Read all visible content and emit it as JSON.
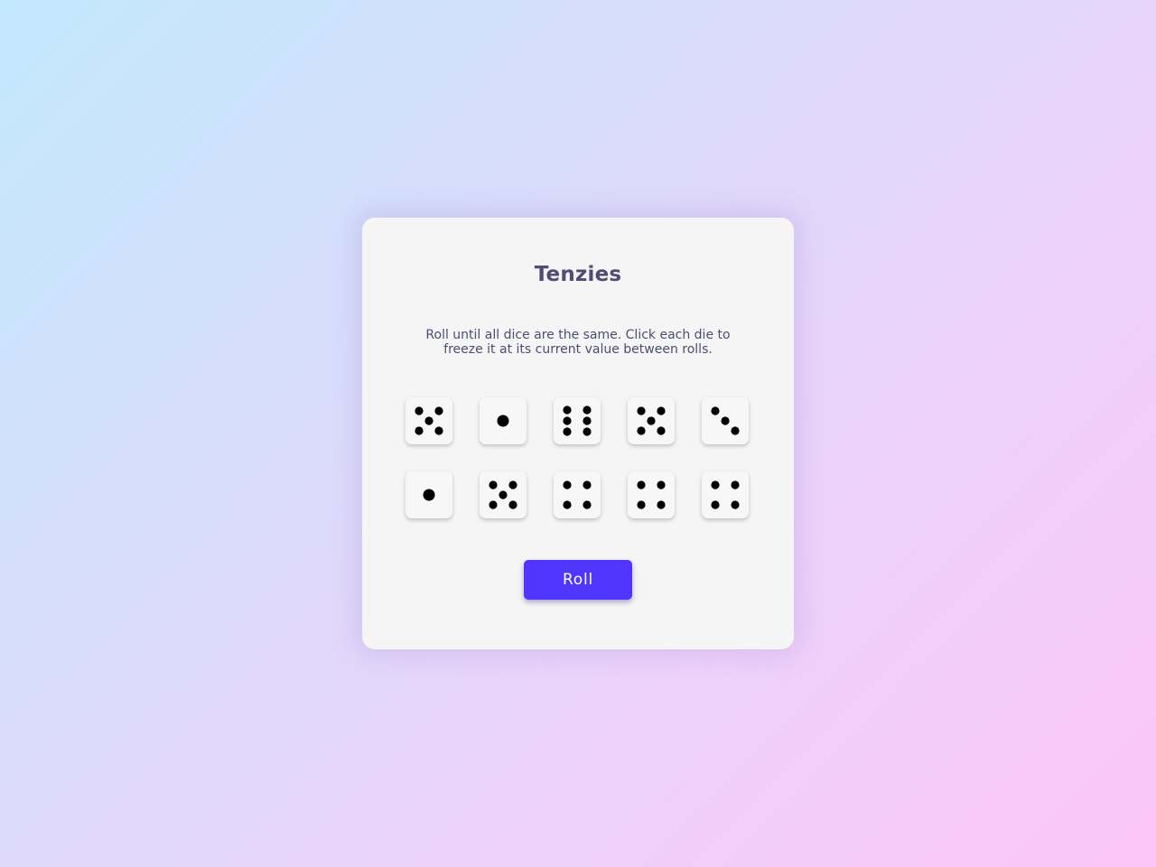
{
  "game": {
    "title": "Tenzies",
    "instructions": "Roll until all dice are the same. Click each die to freeze it at its current value between rolls.",
    "roll_label": "Roll"
  },
  "dice": [
    {
      "value": 5,
      "held": false
    },
    {
      "value": 1,
      "held": false
    },
    {
      "value": 6,
      "held": false
    },
    {
      "value": 5,
      "held": false
    },
    {
      "value": 3,
      "held": false
    },
    {
      "value": 1,
      "held": false
    },
    {
      "value": 5,
      "held": false
    },
    {
      "value": 4,
      "held": false
    },
    {
      "value": 4,
      "held": false
    },
    {
      "value": 4,
      "held": false
    }
  ],
  "colors": {
    "accent": "#5035ff",
    "pip": "#000000",
    "die_face": "#f7f7f7",
    "title_text": "#4f4d77"
  }
}
